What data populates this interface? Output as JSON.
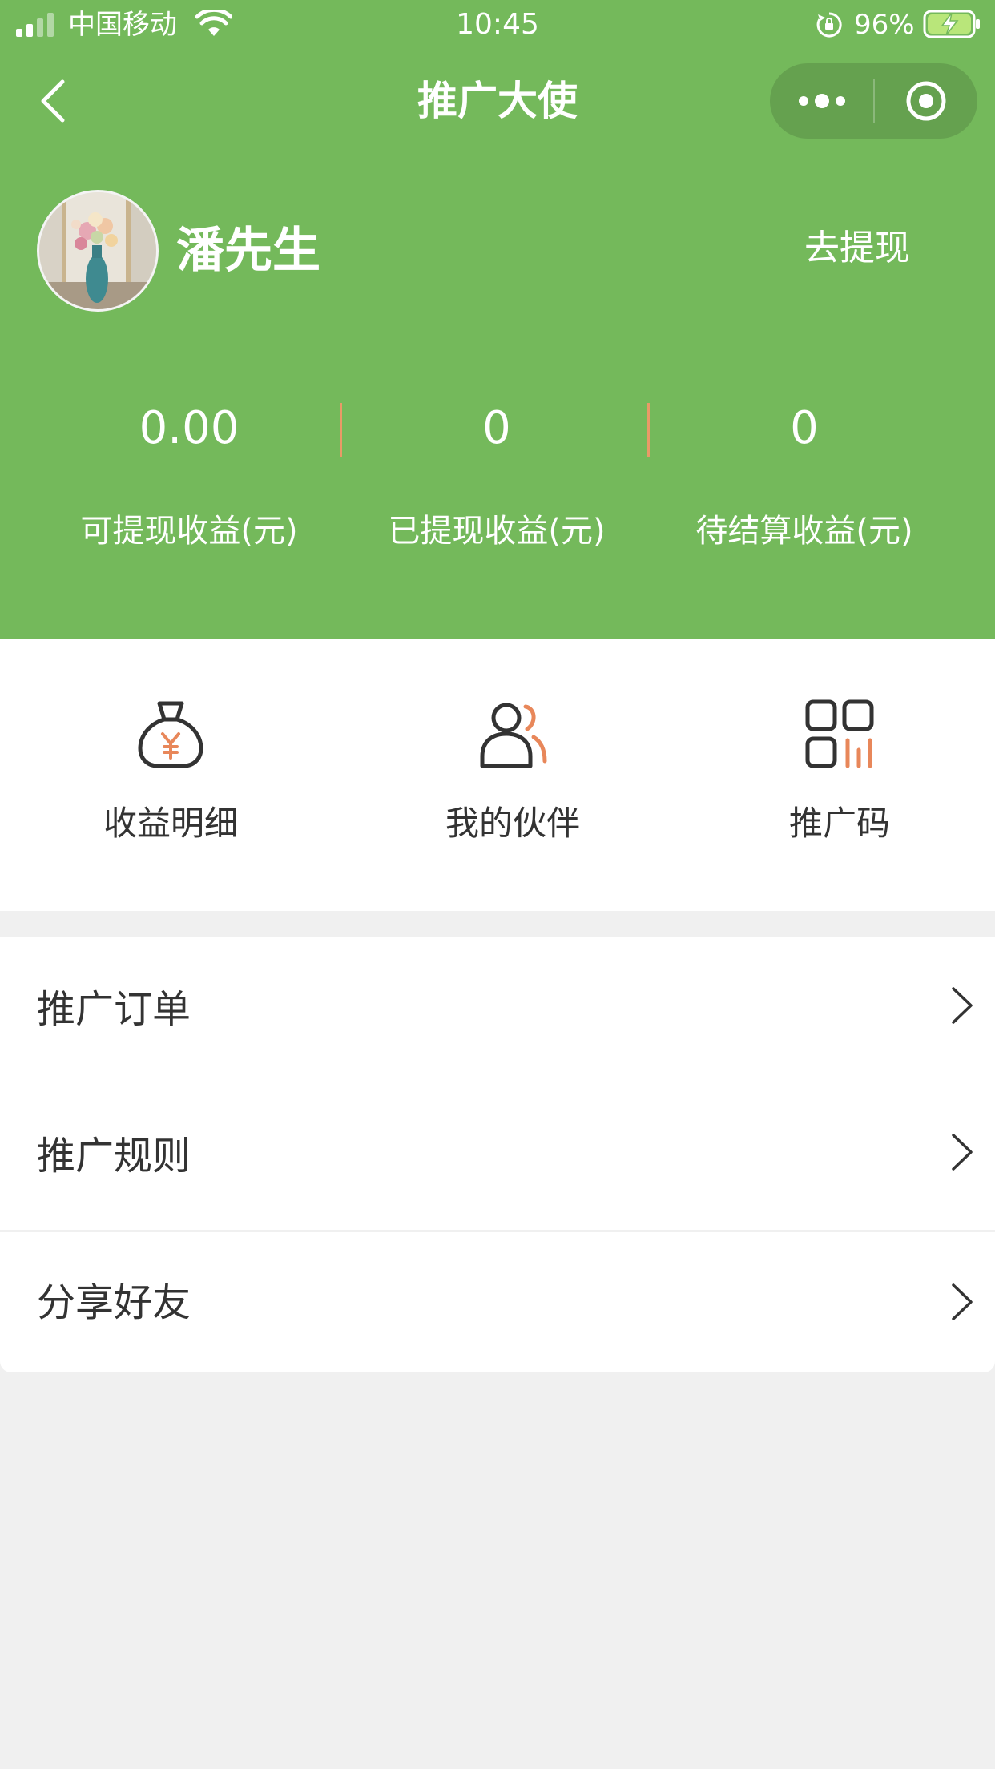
{
  "status_bar": {
    "carrier": "中国移动",
    "time": "10:45",
    "battery_percent": "96%",
    "icons": [
      "signal-icon",
      "wifi-icon",
      "rotation-lock-icon",
      "battery-charging-icon"
    ]
  },
  "nav": {
    "title": "推广大使",
    "back_icon": "chevron-left-icon",
    "more_icon": "more-dots-icon",
    "close_icon": "target-close-icon"
  },
  "profile": {
    "name": "潘先生",
    "withdraw_label": "去提现"
  },
  "stats": [
    {
      "value": "0.00",
      "label": "可提现收益(元)"
    },
    {
      "value": "0",
      "label": "已提现收益(元)"
    },
    {
      "value": "0",
      "label": "待结算收益(元)"
    }
  ],
  "actions": [
    {
      "label": "收益明细",
      "icon": "money-bag-icon"
    },
    {
      "label": "我的伙伴",
      "icon": "partners-icon"
    },
    {
      "label": "推广码",
      "icon": "promo-code-icon"
    }
  ],
  "menu_group_1": [
    {
      "label": "推广订单"
    },
    {
      "label": "推广规则"
    }
  ],
  "menu_group_2": [
    {
      "label": "分享好友"
    }
  ],
  "colors": {
    "header_green": "#74b95b",
    "accent_orange": "#e8875a",
    "divider_orange": "#e99a67",
    "page_bg": "#f0f0f0",
    "text_dark": "#333333"
  }
}
